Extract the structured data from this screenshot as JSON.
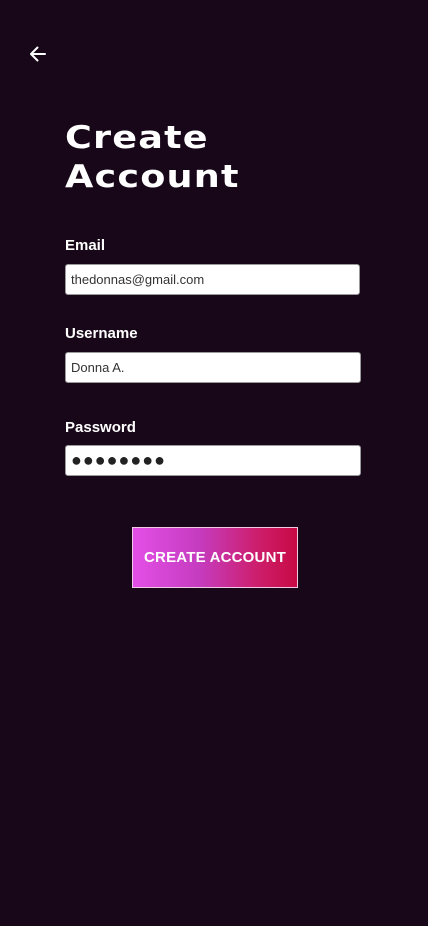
{
  "header": {
    "back_icon": "arrow-left-icon",
    "title_line1": "Create",
    "title_line2": "Account"
  },
  "form": {
    "email": {
      "label": "Email",
      "value": "thedonnas@gmail.com"
    },
    "username": {
      "label": "Username",
      "value": "Donna A."
    },
    "password": {
      "label": "Password",
      "value": "●●●●●●●●"
    },
    "submit_label": "CREATE ACCOUNT"
  },
  "colors": {
    "background": "#170718",
    "button_gradient_start": "#e34fe6",
    "button_gradient_end": "#c80a44"
  }
}
